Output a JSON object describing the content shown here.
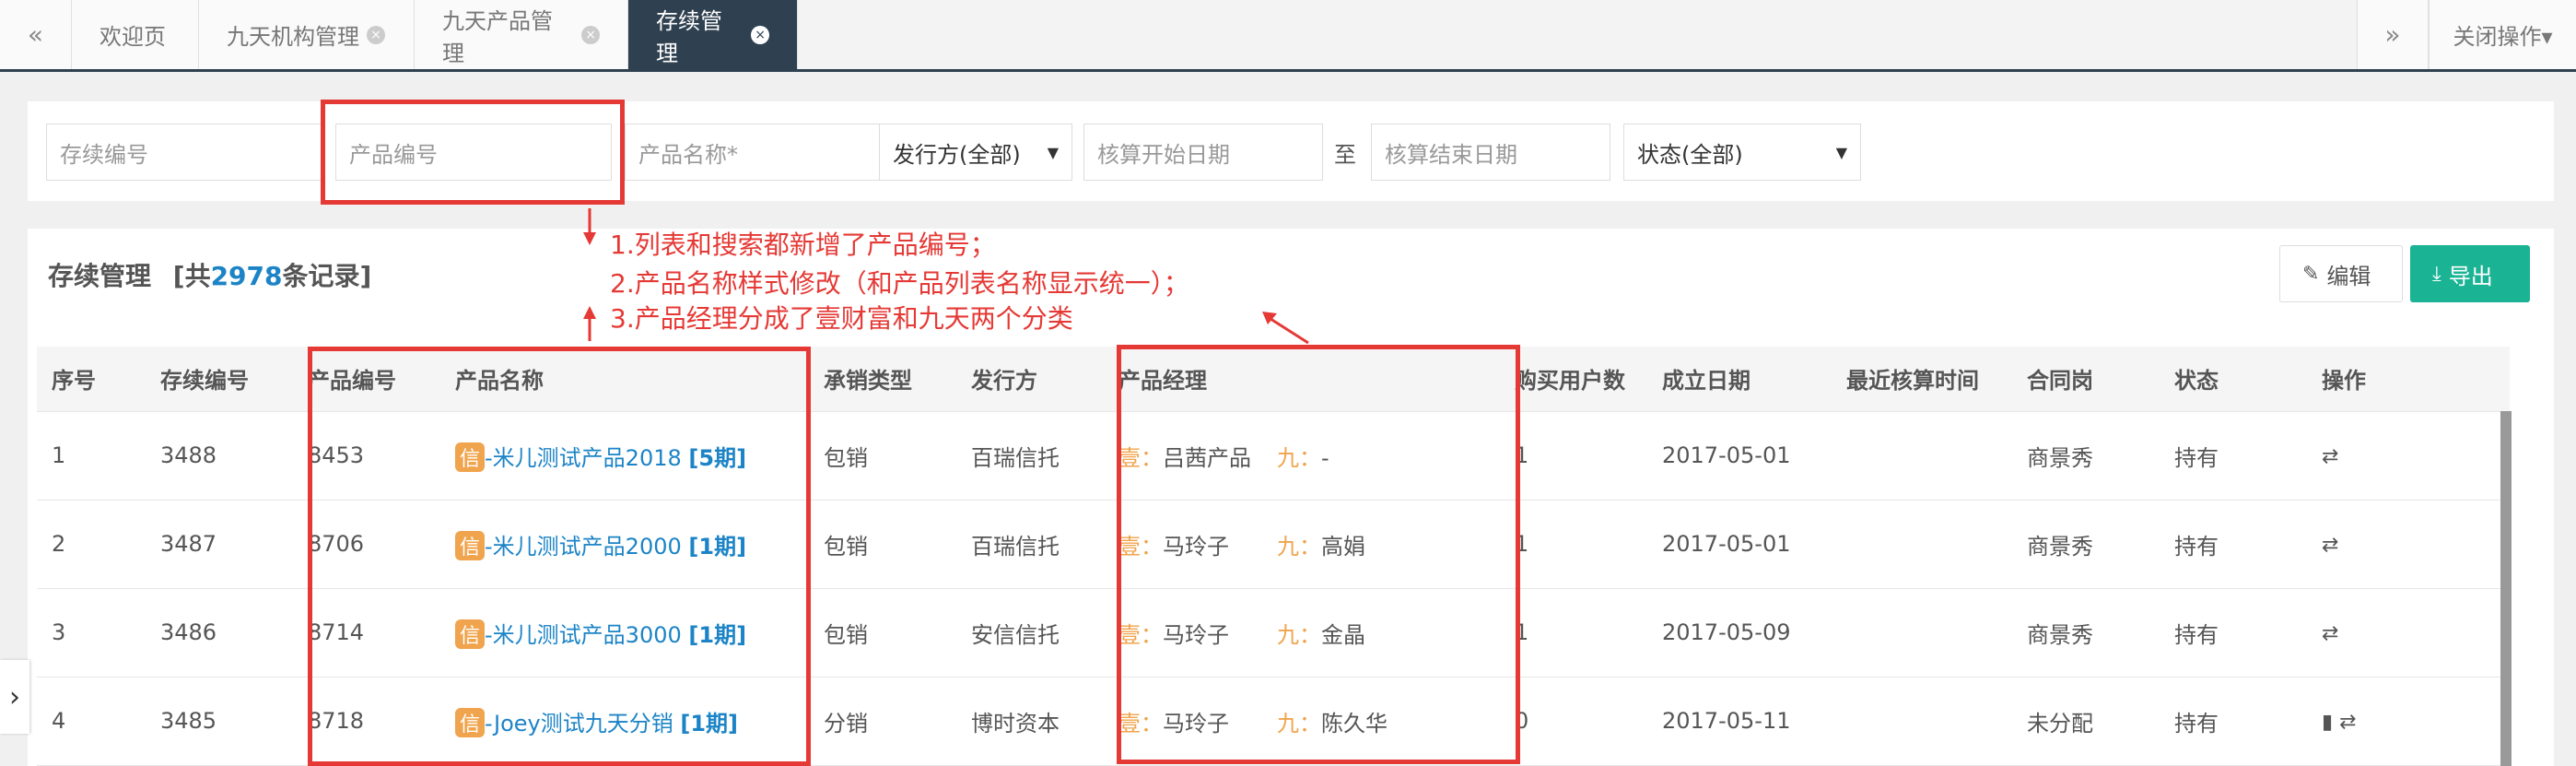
{
  "tabs": {
    "prev": "«",
    "next": "»",
    "close_ops": "关闭操作▾",
    "items": [
      {
        "label": "欢迎页",
        "closable": false
      },
      {
        "label": "九天机构管理",
        "closable": true
      },
      {
        "label": "九天产品管理",
        "closable": true
      },
      {
        "label": "存续管理",
        "closable": true,
        "active": true
      }
    ],
    "close_glyph": "×"
  },
  "search": {
    "cx_no_ph": "存续编号",
    "prod_no_ph": "产品编号",
    "prod_name_ph": "产品名称*",
    "issuer": "发行方(全部)",
    "start_ph": "核算开始日期",
    "to": "至",
    "end_ph": "核算结束日期",
    "status": "状态(全部)",
    "caret": "▼"
  },
  "panel": {
    "title_prefix": "存续管理",
    "count_prefix": "[共",
    "count": "2978",
    "count_suffix": "条记录]",
    "edit_label": "编辑",
    "export_label": "导出"
  },
  "table": {
    "headers": [
      "序号",
      "存续编号",
      "产品编号",
      "产品名称",
      "承销类型",
      "发行方",
      "产品经理",
      "购买用户数",
      "成立日期",
      "最近核算时间",
      "合同岗",
      "状态",
      "操作"
    ],
    "rows": [
      {
        "seq": "1",
        "cx_no": "3488",
        "prod_no": "8453",
        "xin": "信",
        "name": "-米儿测试产品2018",
        "period": "[5期]",
        "type": "包销",
        "issuer": "百瑞信托",
        "yi_lbl": "壹：",
        "yi": "吕茜产品",
        "jiu_lbl": "九：",
        "jiu": "-",
        "buyers": "1",
        "date": "2017-05-01",
        "last": "",
        "contract": "商景秀",
        "status": "持有",
        "ops": "⇄"
      },
      {
        "seq": "2",
        "cx_no": "3487",
        "prod_no": "8706",
        "xin": "信",
        "name": "-米儿测试产品2000",
        "period": "[1期]",
        "type": "包销",
        "issuer": "百瑞信托",
        "yi_lbl": "壹：",
        "yi": "马玲子",
        "jiu_lbl": "九：",
        "jiu": "高娟",
        "buyers": "1",
        "date": "2017-05-01",
        "last": "",
        "contract": "商景秀",
        "status": "持有",
        "ops": "⇄"
      },
      {
        "seq": "3",
        "cx_no": "3486",
        "prod_no": "8714",
        "xin": "信",
        "name": "-米儿测试产品3000",
        "period": "[1期]",
        "type": "包销",
        "issuer": "安信信托",
        "yi_lbl": "壹：",
        "yi": "马玲子",
        "jiu_lbl": "九：",
        "jiu": "金晶",
        "buyers": "1",
        "date": "2017-05-09",
        "last": "",
        "contract": "商景秀",
        "status": "持有",
        "ops": "⇄"
      },
      {
        "seq": "4",
        "cx_no": "3485",
        "prod_no": "8718",
        "xin": "信",
        "name": "-Joey测试九天分销",
        "period": "[1期]",
        "type": "分销",
        "issuer": "博时资本",
        "yi_lbl": "壹：",
        "yi": "马玲子",
        "jiu_lbl": "九：",
        "jiu": "陈久华",
        "buyers": "0",
        "date": "2017-05-11",
        "last": "",
        "contract": "未分配",
        "status": "持有",
        "ops": "▮ ⇄"
      }
    ]
  },
  "annotations": {
    "line1": "1.列表和搜索都新增了产品编号；",
    "line2": "2.产品名称样式修改（和产品列表名称显示统一）；",
    "line3": "3.产品经理分成了壹财富和九天两个分类"
  },
  "colors": {
    "accent_dark": "#2f4050",
    "link": "#1c84c6",
    "export_green": "#1ab394",
    "annotation_red": "#e53935",
    "badge_orange": "#f0a44d"
  }
}
